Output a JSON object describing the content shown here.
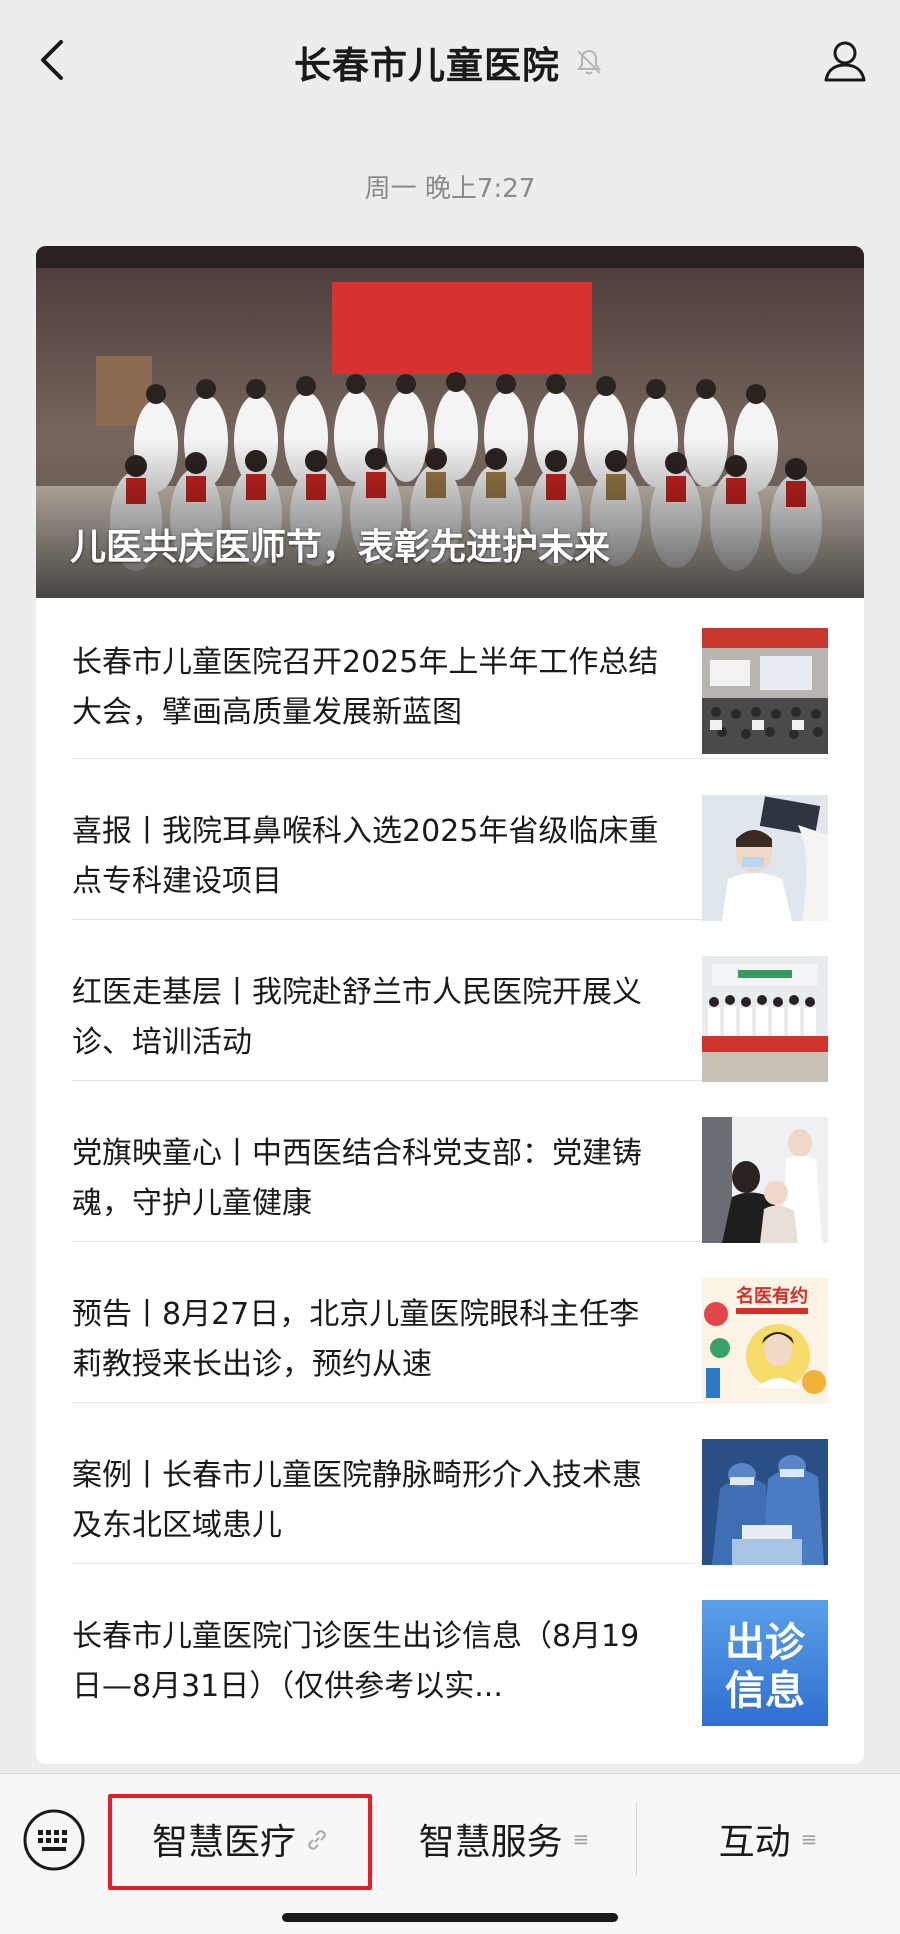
{
  "header": {
    "title": "长春市儿童医院"
  },
  "timestamp": "周一 晚上7:27",
  "cover": {
    "title": "儿医共庆医师节，表彰先进护未来"
  },
  "articles": [
    {
      "title": "长春市儿童医院召开2025年上半年工作总结大会，擘画高质量发展新蓝图",
      "thumb_icon": "meeting-photo"
    },
    {
      "title": "喜报丨我院耳鼻喉科入选2025年省级临床重点专科建设项目",
      "thumb_icon": "doctor-xray-photo"
    },
    {
      "title": "红医走基层丨我院赴舒兰市人民医院开展义诊、培训活动",
      "thumb_icon": "group-photo"
    },
    {
      "title": "党旗映童心丨中西医结合科党支部：党建铸魂，守护儿童健康",
      "thumb_icon": "doctor-child-photo"
    },
    {
      "title": "预告丨8月27日，北京儿童医院眼科主任李莉教授来长出诊，预约从速",
      "thumb_icon": "famous-doctor-poster"
    },
    {
      "title": "案例丨长春市儿童医院静脉畸形介入技术惠及东北区域患儿",
      "thumb_icon": "surgery-photo"
    },
    {
      "title": "长春市儿童医院门诊医生出诊信息（8月19日—8月31日）（仅供参考以实...",
      "thumb_icon": "clinic-info-poster"
    }
  ],
  "thumb_texts": {
    "poster_title": "名医有约",
    "clinic_line1": "出诊",
    "clinic_line2": "信息"
  },
  "menu": {
    "items": [
      {
        "label": "智慧医疗",
        "icon": "link-icon",
        "highlighted": true
      },
      {
        "label": "智慧服务",
        "icon": "menu-icon"
      },
      {
        "label": "互动",
        "icon": "menu-icon"
      }
    ]
  },
  "colors": {
    "background": "#ededed",
    "card": "#ffffff",
    "highlight": "#e3202a"
  }
}
